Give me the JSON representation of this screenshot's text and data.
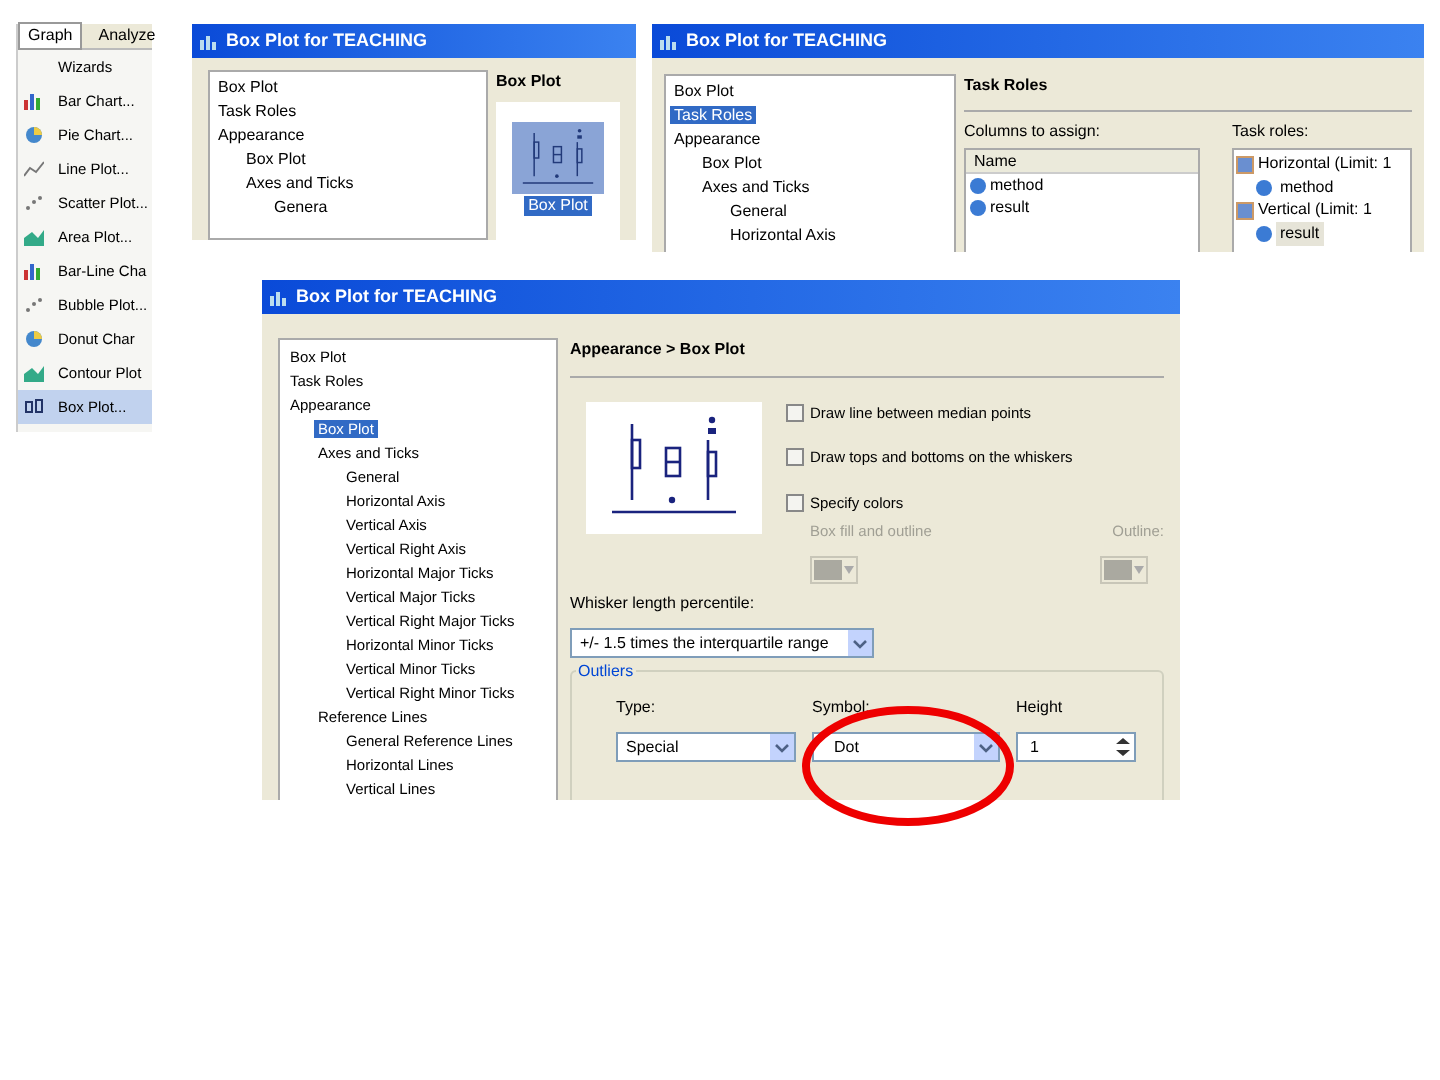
{
  "menu": {
    "tabs": [
      {
        "label": "Graph",
        "selected": true
      },
      {
        "label": "Analyze",
        "selected": false
      }
    ],
    "items": [
      {
        "label": "Wizards",
        "kind": "plain",
        "selected": false
      },
      {
        "label": "Bar Chart...",
        "kind": "bar",
        "selected": false
      },
      {
        "label": "Pie Chart...",
        "kind": "pie",
        "selected": false
      },
      {
        "label": "Line Plot...",
        "kind": "line",
        "selected": false
      },
      {
        "label": "Scatter Plot...",
        "kind": "scatter",
        "selected": false
      },
      {
        "label": "Area Plot...",
        "kind": "area",
        "selected": false
      },
      {
        "label": "Bar-Line Cha",
        "kind": "bar",
        "selected": false
      },
      {
        "label": "Bubble Plot...",
        "kind": "scatter",
        "selected": false
      },
      {
        "label": "Donut Char",
        "kind": "pie",
        "selected": false
      },
      {
        "label": "Contour Plot",
        "kind": "area",
        "selected": false
      },
      {
        "label": "Box Plot...",
        "kind": "box",
        "selected": true
      }
    ]
  },
  "dialog_1": {
    "title": "Box Plot for TEACHING",
    "tree": [
      {
        "label": "Box Plot",
        "selected": false
      },
      {
        "label": "Task Roles",
        "selected": false
      },
      {
        "label": "Appearance",
        "selected": false,
        "children": [
          {
            "label": "Box Plot",
            "selected": false
          },
          {
            "label": "Axes and Ticks",
            "selected": false,
            "children": [
              {
                "label": "Genera",
                "selected": false
              }
            ]
          }
        ]
      }
    ],
    "heading": "Box Plot",
    "tile_label": "Box Plot",
    "tile_selected": true
  },
  "dialog_2": {
    "title": "Box Plot for TEACHING",
    "tree": [
      {
        "label": "Box Plot",
        "selected": false
      },
      {
        "label": "Task Roles",
        "selected": true
      },
      {
        "label": "Appearance",
        "selected": false,
        "children": [
          {
            "label": "Box Plot",
            "selected": false
          },
          {
            "label": "Axes and Ticks",
            "selected": false,
            "children": [
              {
                "label": "General",
                "selected": false
              },
              {
                "label": "Horizontal Axis",
                "selected": false
              }
            ]
          }
        ]
      }
    ],
    "heading": "Task Roles",
    "columns_label": "Columns to assign:",
    "columns_header": "Name",
    "columns": [
      "method",
      "result"
    ],
    "roles_label": "Task roles:",
    "roles": [
      {
        "label": "Horizontal (Limit: 1",
        "children": [
          {
            "label": "method",
            "selected": false
          }
        ]
      },
      {
        "label": "Vertical (Limit: 1",
        "children": [
          {
            "label": "result",
            "selected": true
          }
        ]
      }
    ]
  },
  "dialog_3": {
    "title": "Box Plot for TEACHING",
    "tree": [
      {
        "label": "Box Plot",
        "selected": false
      },
      {
        "label": "Task Roles",
        "selected": false
      },
      {
        "label": "Appearance",
        "selected": false,
        "children": [
          {
            "label": "Box Plot",
            "selected": true
          },
          {
            "label": "Axes and Ticks",
            "selected": false,
            "children": [
              {
                "label": "General",
                "selected": false
              },
              {
                "label": "Horizontal Axis",
                "selected": false
              },
              {
                "label": "Vertical Axis",
                "selected": false
              },
              {
                "label": "Vertical Right Axis",
                "selected": false
              },
              {
                "label": "Horizontal Major Ticks",
                "selected": false
              },
              {
                "label": "Vertical Major Ticks",
                "selected": false
              },
              {
                "label": "Vertical Right Major Ticks",
                "selected": false
              },
              {
                "label": "Horizontal Minor Ticks",
                "selected": false
              },
              {
                "label": "Vertical Minor Ticks",
                "selected": false
              },
              {
                "label": "Vertical Right Minor Ticks",
                "selected": false
              }
            ]
          },
          {
            "label": "Reference Lines",
            "selected": false,
            "children": [
              {
                "label": "General Reference Lines",
                "selected": false
              },
              {
                "label": "Horizontal Lines",
                "selected": false
              },
              {
                "label": "Vertical Lines",
                "selected": false
              }
            ]
          }
        ]
      }
    ],
    "breadcrumb": "Appearance > Box Plot",
    "options": [
      {
        "label": "Draw line between median points",
        "checked": false
      },
      {
        "label": "Draw tops and bottoms on the whiskers",
        "checked": false
      },
      {
        "label": "Specify colors",
        "checked": false
      }
    ],
    "color_labels": [
      "Box fill and outline",
      "Outline:"
    ],
    "whisker_label": "Whisker length percentile:",
    "whisker_value": "+/- 1.5 times the interquartile range",
    "outliers_label": "Outliers",
    "type_label": "Type:",
    "type_value": "Special",
    "symbol_label": "Symbol:",
    "symbol_value": "Dot",
    "height_label": "Height",
    "height_value": "1"
  }
}
